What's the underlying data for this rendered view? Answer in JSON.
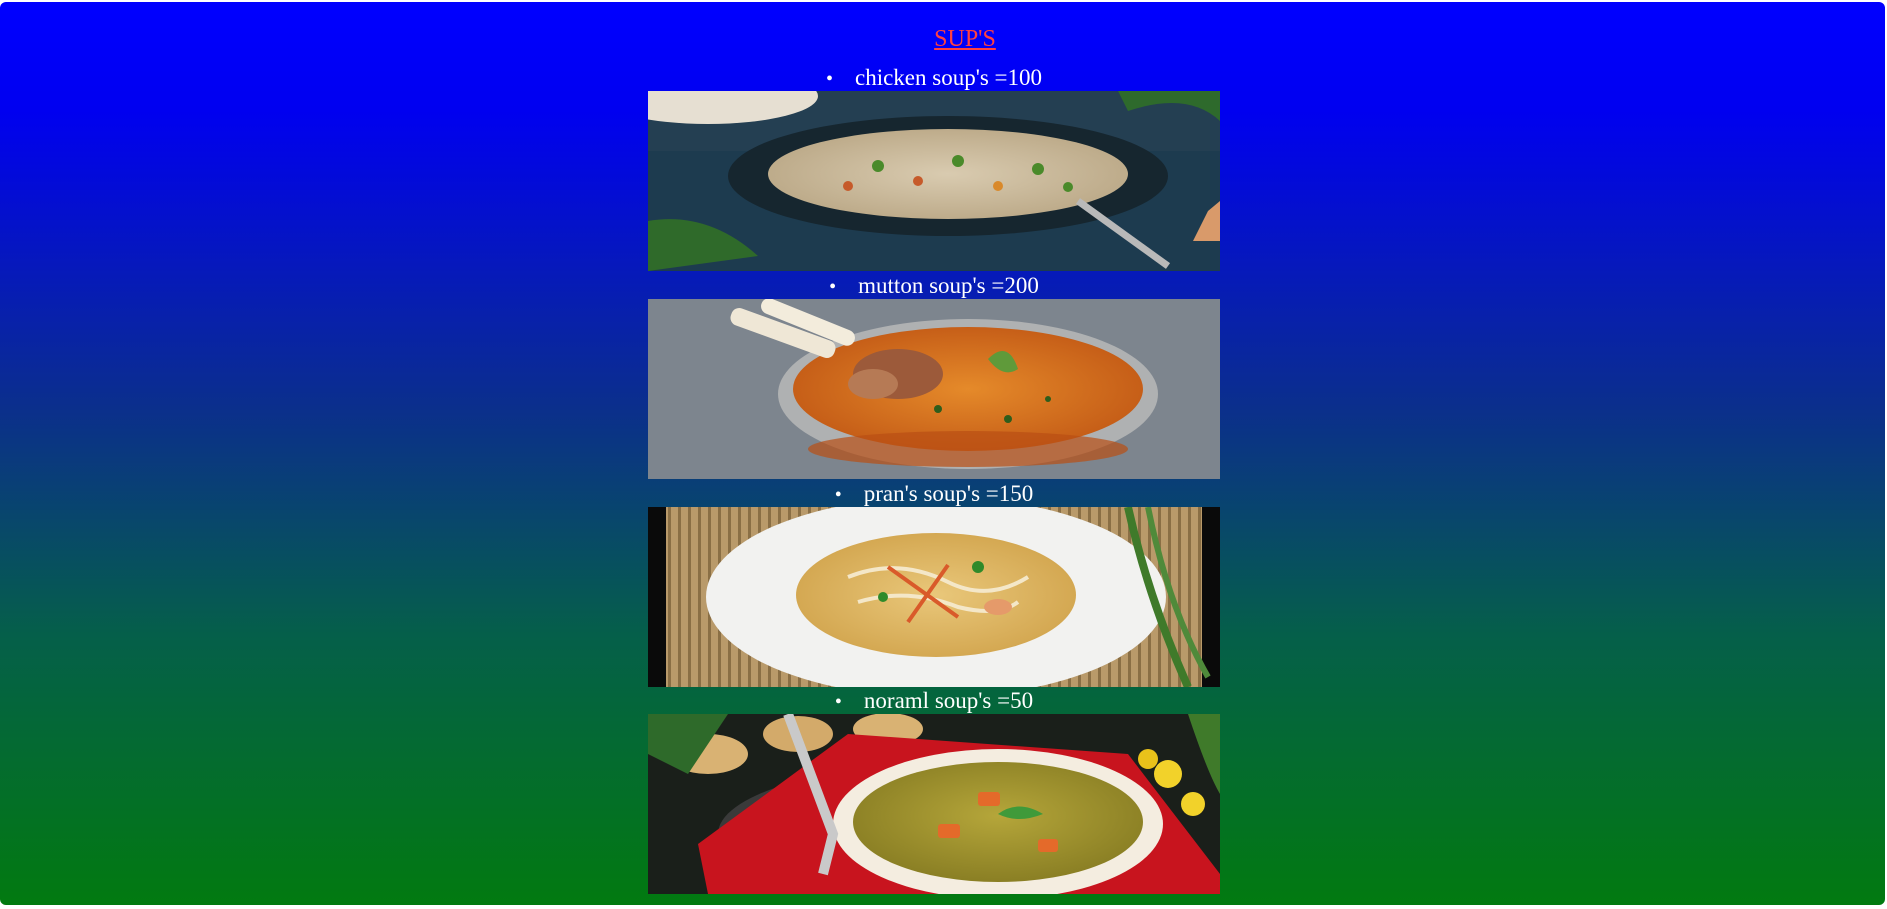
{
  "page": {
    "title": "SUP'S",
    "colors": {
      "background_top": "#0000ff",
      "background_bottom": "#027a10",
      "title": "#ff4040",
      "text": "#ffffff"
    }
  },
  "items": [
    {
      "bullet": "•",
      "label": "chicken soup's =100",
      "image": "chicken-soup-photo"
    },
    {
      "bullet": "•",
      "label": "mutton soup's =200",
      "image": "mutton-soup-photo"
    },
    {
      "bullet": "•",
      "label": "pran's soup's =150",
      "image": "prawn-soup-photo"
    },
    {
      "bullet": "•",
      "label": "noraml soup's =50",
      "image": "vegetable-soup-photo"
    }
  ]
}
